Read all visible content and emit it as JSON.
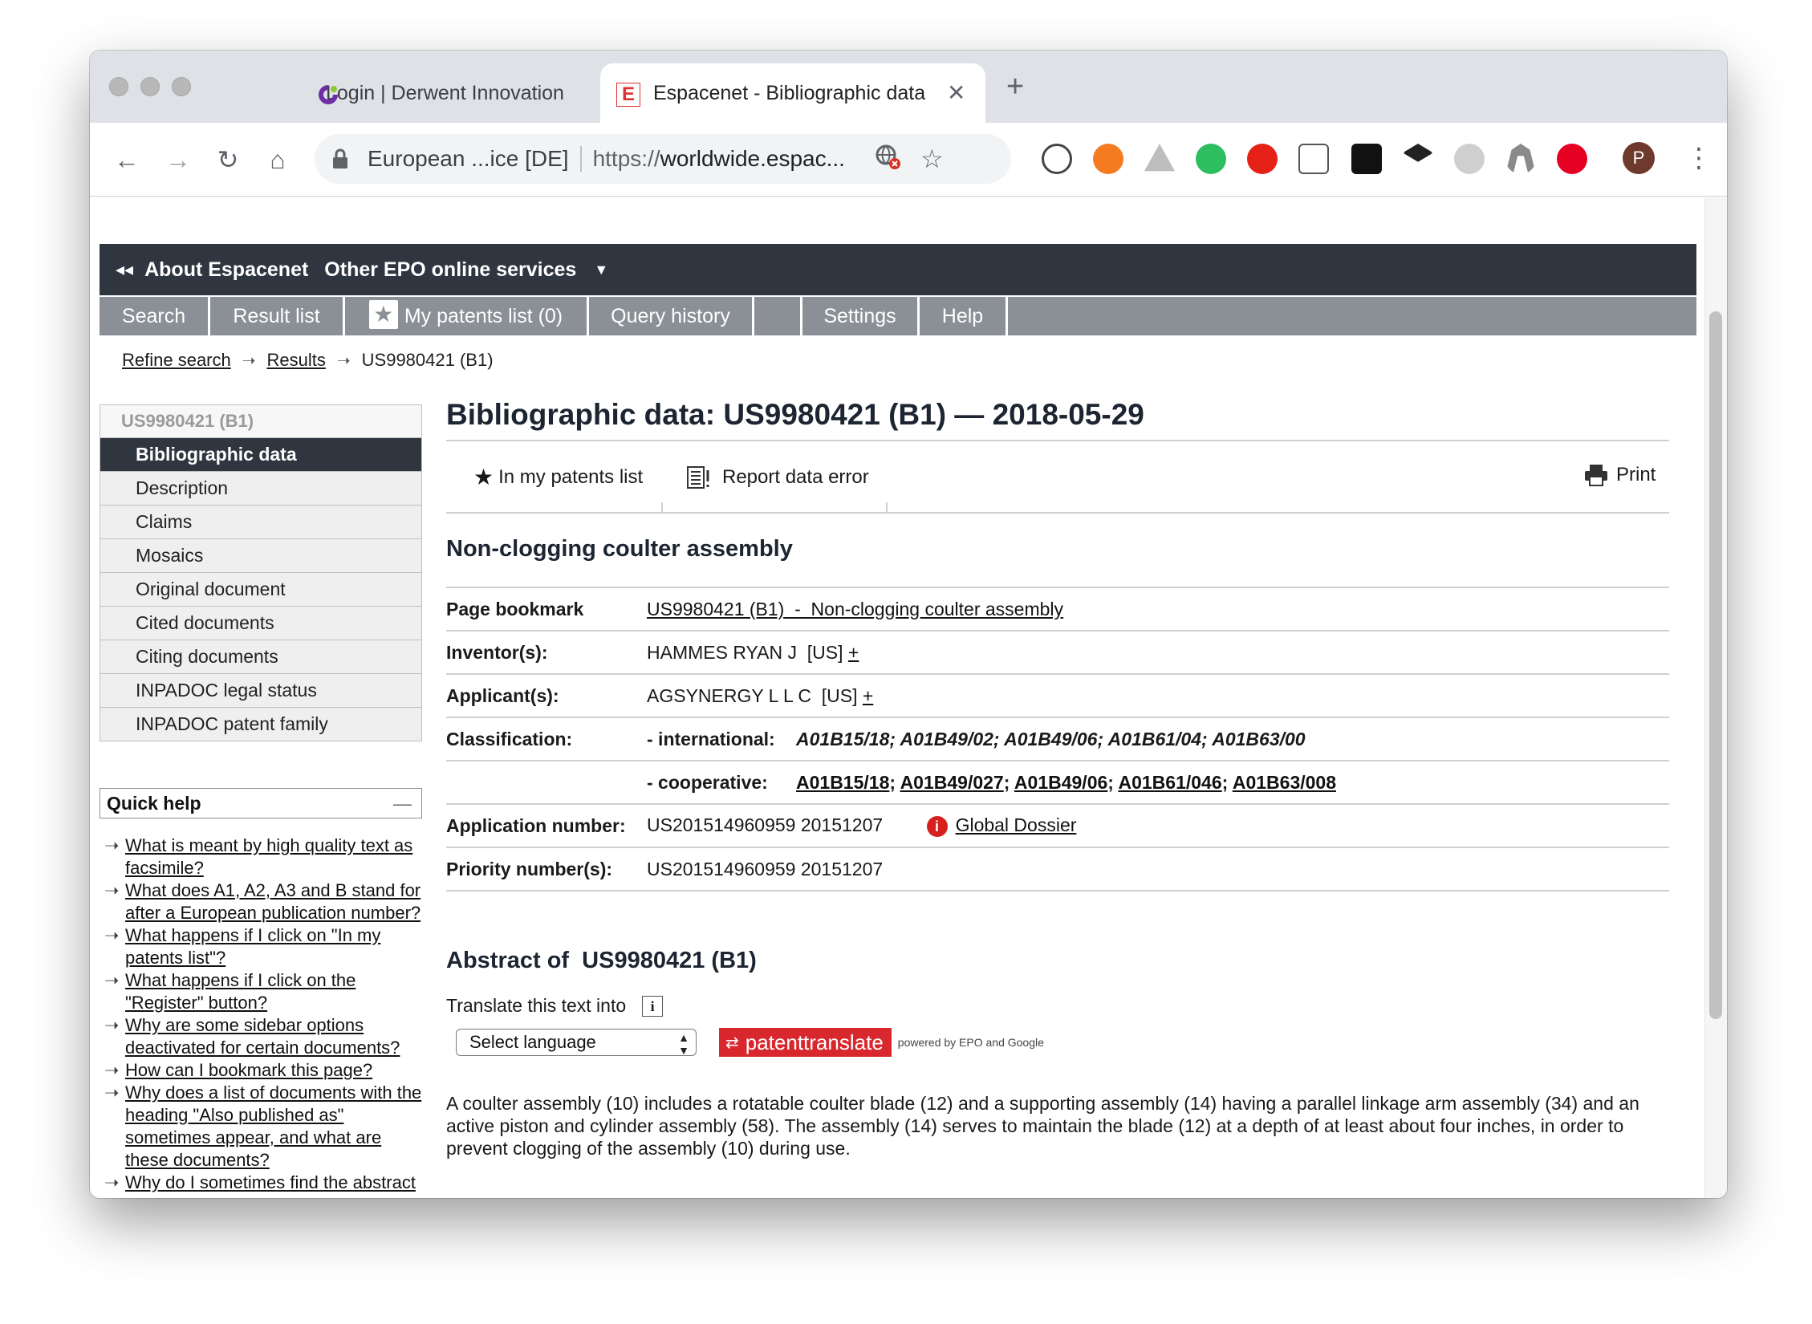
{
  "browser": {
    "tabs": [
      {
        "title": "Login | Derwent Innovation"
      },
      {
        "title": "Espacenet - Bibliographic data"
      }
    ],
    "omnibox": {
      "site": "European ...ice [DE]",
      "url_scheme": "https://",
      "url_rest": "worldwide.espac..."
    },
    "avatar_letter": "P"
  },
  "epo": {
    "top": {
      "about": "About Espacenet",
      "other": "Other EPO online services"
    },
    "menu": {
      "search": "Search",
      "result_list": "Result list",
      "my_patents": "My patents list (0)",
      "query_history": "Query history",
      "settings": "Settings",
      "help": "Help"
    },
    "breadcrumb": {
      "refine": "Refine search",
      "results": "Results",
      "current": "US9980421 (B1)"
    }
  },
  "sidebar": {
    "head": "US9980421 (B1)",
    "items": [
      {
        "label": "Bibliographic data"
      },
      {
        "label": "Description"
      },
      {
        "label": "Claims"
      },
      {
        "label": "Mosaics"
      },
      {
        "label": "Original document"
      },
      {
        "label": "Cited documents"
      },
      {
        "label": "Citing documents"
      },
      {
        "label": "INPADOC legal status"
      },
      {
        "label": "INPADOC patent family"
      }
    ]
  },
  "quickhelp": {
    "title": "Quick help",
    "items": [
      {
        "text": "What is meant by high quality text as facsimile?"
      },
      {
        "text": "What does A1, A2, A3 and B stand for after a European publication number?"
      },
      {
        "text": "What happens if I click on \"In my patents list\"?"
      },
      {
        "text": "What happens if I click on the \"Register\" button?"
      },
      {
        "text": "Why are some sidebar options deactivated for certain documents?"
      },
      {
        "text": "How can I bookmark this page?"
      },
      {
        "text": "Why does a list of documents with the heading \"Also published as\" sometimes appear, and what are these documents?"
      },
      {
        "text": "Why do I sometimes find the abstract of a corresponding"
      }
    ]
  },
  "main": {
    "title": "Bibliographic data: US9980421 (B1) — 2018-05-29",
    "actions": {
      "in_my_patents": "In my patents list",
      "report_error": "Report data error",
      "print": "Print"
    },
    "subtitle": "Non-clogging coulter assembly",
    "biblio": {
      "page_bookmark_label": "Page bookmark",
      "page_bookmark_value": "US9980421 (B1)  -  Non-clogging coulter assembly",
      "inventors_label": "Inventor(s):",
      "inventors_value": "HAMMES RYAN J  [US]",
      "applicants_label": "Applicant(s):",
      "applicants_value": "AGSYNERGY L L C  [US]",
      "plus": "+",
      "classification_label": "Classification:",
      "intl_label": "- international:",
      "intl_value": "A01B15/18; A01B49/02; A01B49/06; A01B61/04; A01B63/00",
      "coop_label": "- cooperative:",
      "coop_codes": [
        "A01B15/18",
        "A01B49/027",
        "A01B49/06",
        "A01B61/046",
        "A01B63/008"
      ],
      "application_label": "Application number:",
      "application_value": "US201514960959 20151207",
      "global_dossier": "Global Dossier",
      "priority_label": "Priority number(s):",
      "priority_value": "US201514960959 20151207"
    },
    "abstract_title": "Abstract of  US9980421 (B1)",
    "translate_label": "Translate this text into",
    "select_language": "Select language",
    "patenttranslate": "patenttranslate",
    "powered": "powered by EPO and Google",
    "abstract_text": "A coulter assembly (10) includes a rotatable coulter blade (12) and a supporting assembly (14) having a parallel linkage arm assembly (34) and an active piston and cylinder assembly (58). The assembly (14) serves to maintain the blade (12) at a depth of at least about four inches, in order to prevent clogging of the assembly (10) during use."
  }
}
